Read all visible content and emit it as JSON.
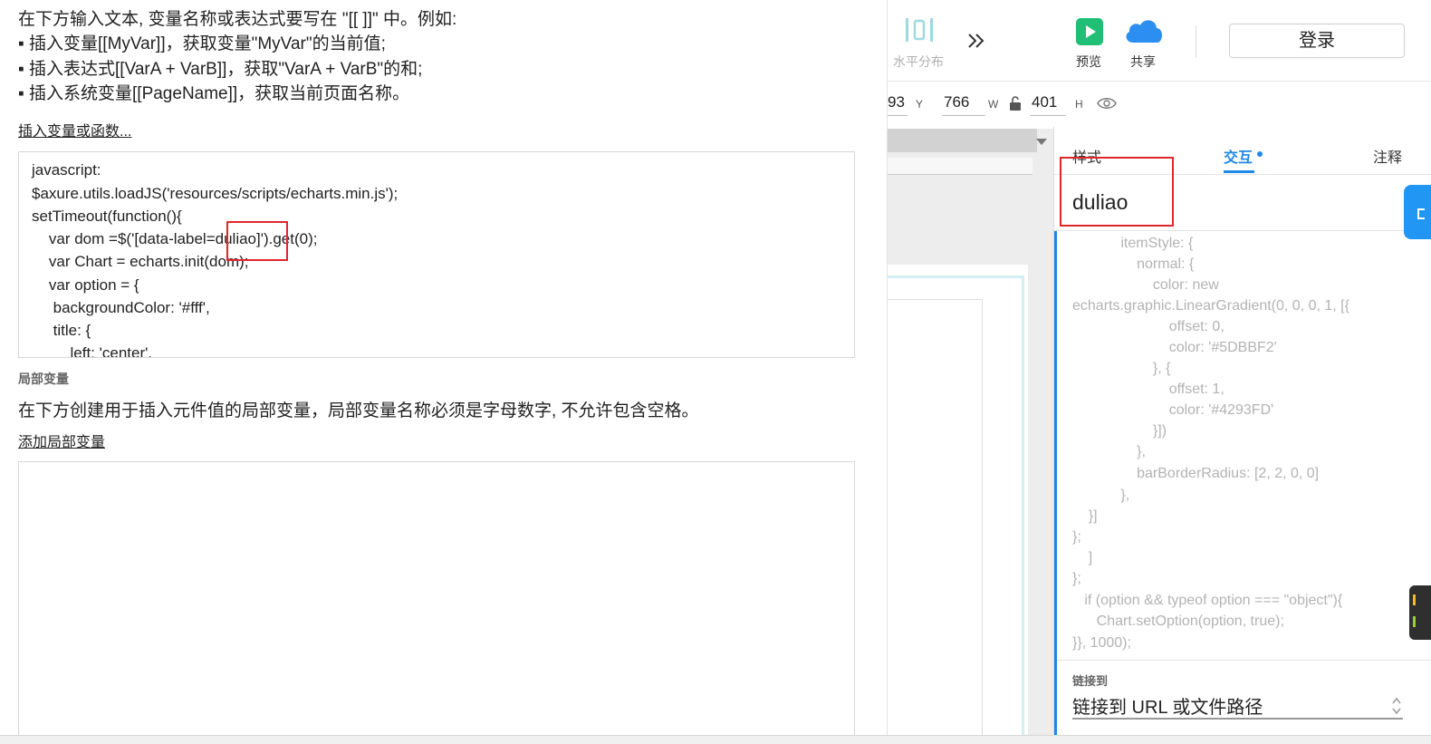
{
  "dialog": {
    "intro_lines": [
      "在下方输入文本, 变量名称或表达式要写在 \"[[ ]]\" 中。例如:",
      "▪ 插入变量[[MyVar]]，获取变量\"MyVar\"的当前值;",
      "▪ 插入表达式[[VarA + VarB]]，获取\"VarA + VarB\"的和;",
      "▪ 插入系统变量[[PageName]]，获取当前页面名称。"
    ],
    "insert_link": "插入变量或函数...",
    "code_lines": [
      "javascript:",
      "$axure.utils.loadJS('resources/scripts/echarts.min.js');",
      "setTimeout(function(){",
      "    var dom =$('[data-label=duliao]').get(0);",
      "    var Chart = echarts.init(dom);",
      "    var option = {",
      "     backgroundColor: '#fff',",
      "     title: {",
      "         left: 'center',"
    ],
    "local_vars_title": "局部变量",
    "local_vars_desc": "在下方创建用于插入元件值的局部变量，局部变量名称必须是字母数字, 不允许包含空格。",
    "add_local_var_link": "添加局部变量"
  },
  "toolbar": {
    "distribute_label": "水平分布",
    "more_icon": "double-chevron-right-icon",
    "preview_label": "预览",
    "share_label": "共享",
    "login_label": "登录"
  },
  "coords": {
    "x_partial": "93",
    "y_label": "Y",
    "y_value": "766",
    "w_label": "W",
    "w_value": "401",
    "h_label": "H"
  },
  "panel": {
    "tabs": [
      "样式",
      "交互",
      "注释"
    ],
    "active_tab": "交互",
    "element_name": "duliao",
    "code_lines": [
      "            itemStyle: {",
      "                normal: {",
      "                    color: new",
      "echarts.graphic.LinearGradient(0, 0, 0, 1, [{",
      "                        offset: 0,",
      "                        color: '#5DBBF2'",
      "                    }, {",
      "                        offset: 1,",
      "                        color: '#4293FD'",
      "                    }])",
      "                },",
      "                barBorderRadius: [2, 2, 0, 0]",
      "            },",
      "    }]",
      "};",
      "    ]",
      "};",
      "   if (option && typeof option === \"object\"){",
      "      Chart.setOption(option, true);",
      "}}, 1000);"
    ],
    "link_label": "链接到",
    "link_value": "链接到 URL 或文件路径"
  },
  "colors": {
    "highlight": "#e0262b",
    "accent_blue": "#1e88e5",
    "preview_green": "#1fbf75",
    "cloud_blue": "#2b8ef0"
  }
}
